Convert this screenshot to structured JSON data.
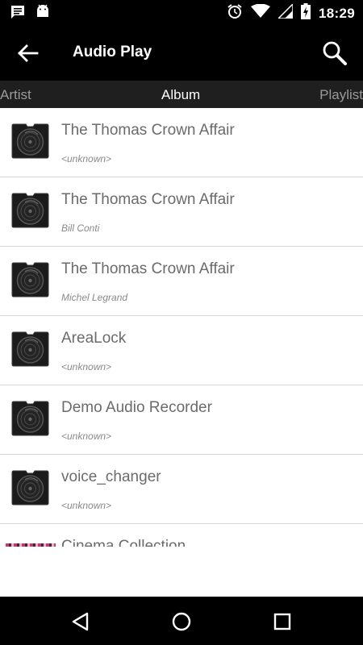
{
  "status_bar": {
    "time": "18:29",
    "left_icons": [
      "message-icon",
      "android-icon"
    ],
    "right_icons": [
      "alarm-icon",
      "wifi-icon",
      "signal-icon",
      "battery-charging-icon"
    ]
  },
  "app_bar": {
    "title": "Audio Play",
    "back_icon": "arrow-left-icon",
    "search_icon": "search-icon"
  },
  "tabs": [
    {
      "label": "Artist",
      "active": false
    },
    {
      "label": "Album",
      "active": true
    },
    {
      "label": "Playlist",
      "active": false
    }
  ],
  "albums": [
    {
      "title": "The Thomas Crown Affair",
      "artist": "<unknown>"
    },
    {
      "title": "The Thomas Crown Affair",
      "artist": "Bill Conti"
    },
    {
      "title": "The Thomas Crown Affair",
      "artist": "Michel Legrand"
    },
    {
      "title": "AreaLock",
      "artist": "<unknown>"
    },
    {
      "title": "Demo Audio Recorder",
      "artist": "<unknown>"
    },
    {
      "title": "voice_changer",
      "artist": "<unknown>"
    },
    {
      "title": "Cinema Collection",
      "artist": ""
    }
  ],
  "nav_bar": {
    "icons": [
      "nav-back-icon",
      "nav-home-icon",
      "nav-recents-icon"
    ]
  }
}
